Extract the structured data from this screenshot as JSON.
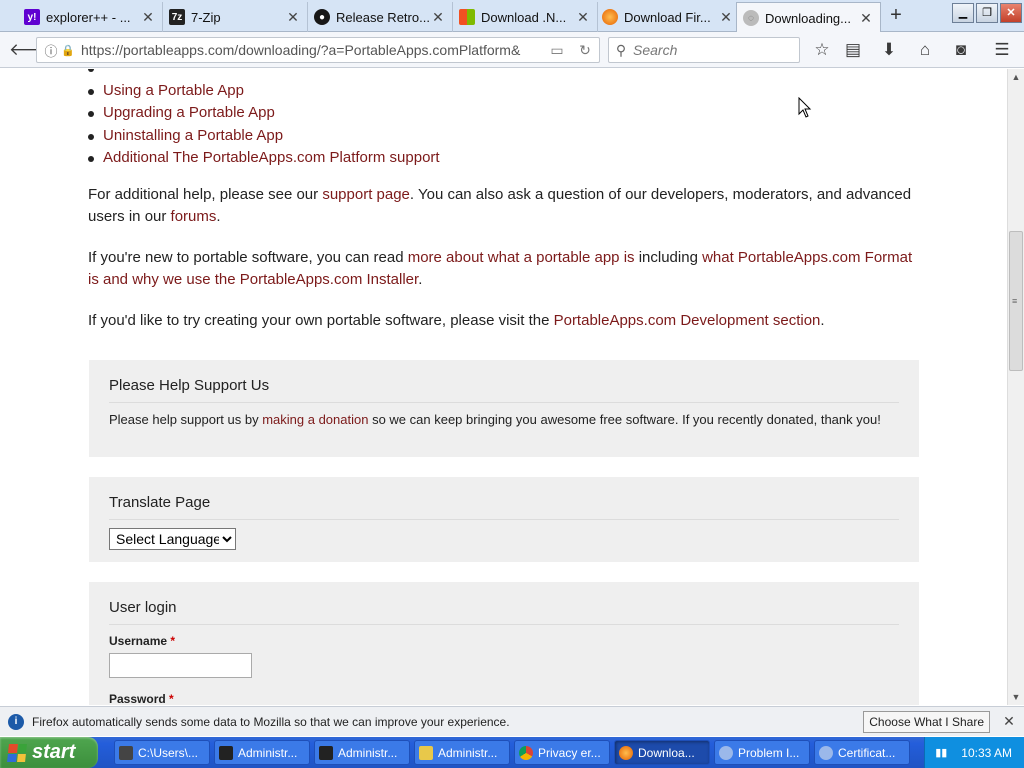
{
  "tabs": [
    {
      "label": "explorer++ - ...",
      "icon": "yahoo-icon",
      "color": "#5f01d1",
      "glyph": "y!"
    },
    {
      "label": "7-Zip",
      "icon": "7zip-icon",
      "color": "#222222",
      "glyph": "7z"
    },
    {
      "label": "Release Retro...",
      "icon": "github-icon",
      "color": "#181717",
      "glyph": "●"
    },
    {
      "label": "Download .N...",
      "icon": "microsoft-icon",
      "color": "#f25022",
      "glyph": "■"
    },
    {
      "label": "Download Fir...",
      "icon": "firefox-icon",
      "color": "#e66000",
      "glyph": "●"
    },
    {
      "label": "Downloading...",
      "icon": "loading-icon",
      "color": "#888888",
      "glyph": "◌"
    }
  ],
  "nav": {
    "url": "https://portableapps.com/downloading/?a=PortableApps.comPlatform&",
    "search_placeholder": "Search"
  },
  "content": {
    "bullets": [
      "Using a Portable App",
      "Upgrading a Portable App",
      "Uninstalling a Portable App",
      "Additional The PortableApps.com Platform support"
    ],
    "para1": {
      "pre": "For additional help, please see our ",
      "link1": "support page",
      "mid": ". You can also ask a question of our developers, moderators, and advanced users in our ",
      "link2": "forums",
      "post": "."
    },
    "para2": {
      "pre": "If you're new to portable software, you can read ",
      "link1": "more about what a portable app is",
      "mid": " including ",
      "link2": "what PortableApps.com Format is and why we use the PortableApps.com Installer",
      "post": "."
    },
    "para3": {
      "pre": "If you'd like to try creating your own portable software, please visit the ",
      "link": "PortableApps.com Development section",
      "post": "."
    },
    "support": {
      "title": "Please Help Support Us",
      "pre": "Please help support us by ",
      "link": "making a donation",
      "post": " so we can keep bringing you awesome free software. If you recently donated, thank you!"
    },
    "translate": {
      "title": "Translate Page",
      "select_value": "Select Language"
    },
    "login": {
      "title": "User login",
      "username_label": "Username",
      "password_label": "Password",
      "required_mark": "*"
    }
  },
  "notification": {
    "message": "Firefox automatically sends some data to Mozilla so that we can improve your experience.",
    "button": "Choose What I Share"
  },
  "taskbar": {
    "start_label": "start",
    "tasks": [
      {
        "label": "C:\\Users\\...",
        "color": "#444444"
      },
      {
        "label": "Administr...",
        "color": "#222222"
      },
      {
        "label": "Administr...",
        "color": "#222222"
      },
      {
        "label": "Administr...",
        "color": "#e8c84a"
      },
      {
        "label": "Privacy er...",
        "color": "#db4437"
      },
      {
        "label": "Downloa...",
        "color": "#e66000",
        "active": true
      },
      {
        "label": "Problem I...",
        "color": "#9bb8ea"
      },
      {
        "label": "Certificat...",
        "color": "#9bb8ea"
      }
    ],
    "clock": "10:33 AM"
  }
}
